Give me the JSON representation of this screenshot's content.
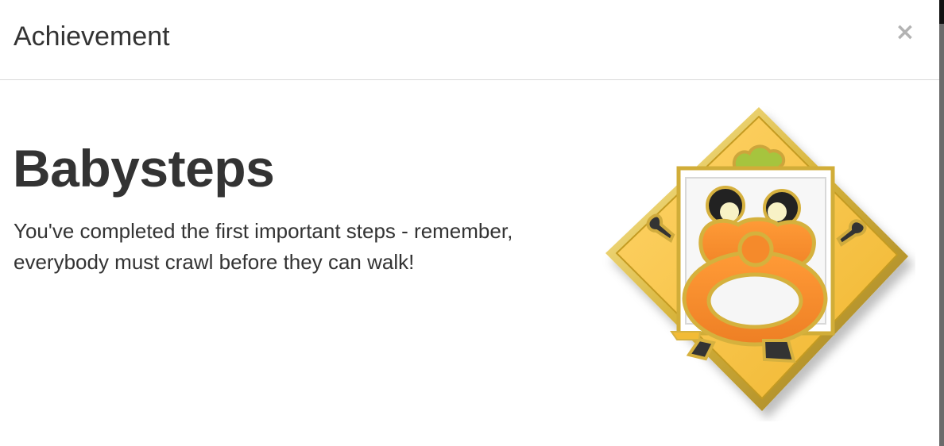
{
  "dialog": {
    "title": "Achievement",
    "close_label": "×"
  },
  "achievement": {
    "name": "Babysteps",
    "description": "You've completed the first important steps - remember, everybody must crawl before they can walk!",
    "badge_icon": "babysteps-badge-icon"
  },
  "colors": {
    "badge_yellow": "#f2bb36",
    "badge_gold": "#d8b53d",
    "badge_orange": "#f18a2b",
    "badge_green": "#a6c43e",
    "close_gray": "#b3b3b3",
    "divider": "#d9d9d9",
    "text": "#333333"
  }
}
